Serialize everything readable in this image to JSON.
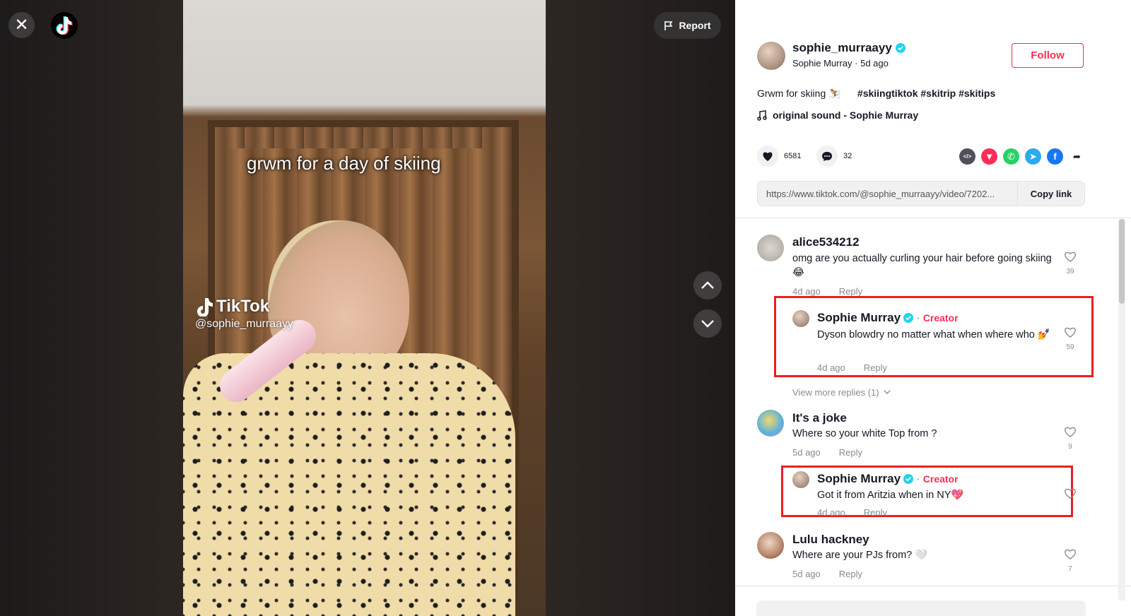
{
  "top_bar": {
    "report_label": "Report"
  },
  "video": {
    "caption": "grwm for a day of skiing",
    "watermark_brand": "TikTok",
    "watermark_handle": "@sophie_murraayy"
  },
  "author": {
    "username": "sophie_murraayy",
    "display_name": "Sophie Murray",
    "posted": "5d ago",
    "follow_label": "Follow"
  },
  "post": {
    "description": "Grwm for skiing ⛷️",
    "hashtags": [
      "#skiingtiktok",
      "#skitrip",
      "#skitips"
    ],
    "music": "original sound - Sophie Murray",
    "likes": "6581",
    "comments_count": "32",
    "link": "https://www.tiktok.com/@sophie_murraayy/video/7202...",
    "copy_label": "Copy link"
  },
  "share_icons": [
    {
      "name": "embed-icon",
      "color": "#4f5058",
      "glyph": "</>"
    },
    {
      "name": "send-to-friends-icon",
      "color": "#fe2c55",
      "glyph": "▼"
    },
    {
      "name": "whatsapp-icon",
      "color": "#25d366",
      "glyph": "✆"
    },
    {
      "name": "telegram-icon",
      "color": "#2aabee",
      "glyph": "➤"
    },
    {
      "name": "facebook-icon",
      "color": "#1877f2",
      "glyph": "f"
    },
    {
      "name": "share-arrow-icon",
      "color": "#ffffff",
      "glyph": "➦"
    }
  ],
  "comments": {
    "c1": {
      "user": "alice534212",
      "text": "omg are you actually curling your hair before going skiing 😂",
      "time": "4d ago",
      "reply": "Reply",
      "likes": "39"
    },
    "r1": {
      "user": "Sophie Murray",
      "badge": "Creator",
      "text": "Dyson blowdry no matter what when where who 💅",
      "time": "4d ago",
      "reply": "Reply",
      "likes": "59"
    },
    "view_more": "View more replies (1)",
    "c2": {
      "user": "It's a joke",
      "text": "Where so your white Top from ?",
      "time": "5d ago",
      "reply": "Reply",
      "likes": "9"
    },
    "r2": {
      "user": "Sophie Murray",
      "badge": "Creator",
      "text": "Got it from Aritzia when in NY💖",
      "time": "4d ago",
      "reply": "Reply"
    },
    "c3": {
      "user": "Lulu hackney",
      "text": "Where are your PJs from? 🤍",
      "time": "5d ago",
      "reply": "Reply",
      "likes": "7"
    }
  },
  "colors": {
    "accent": "#fe2c55",
    "verified": "#20d5ec",
    "highlight": "#e8201f"
  }
}
